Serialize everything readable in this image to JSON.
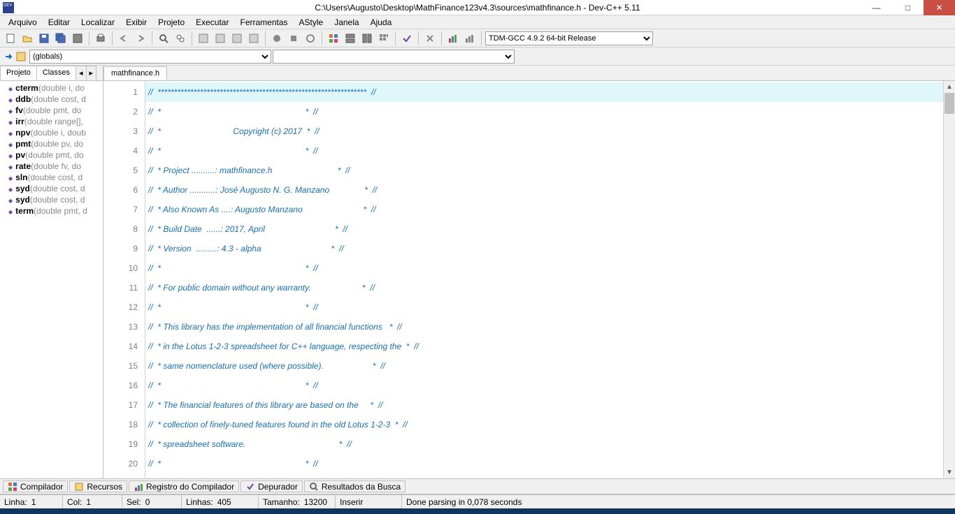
{
  "title": "C:\\Users\\Augusto\\Desktop\\MathFinance123v4.3\\sources\\mathfinance.h - Dev-C++ 5.11",
  "menu": [
    "Arquivo",
    "Editar",
    "Localizar",
    "Exibir",
    "Projeto",
    "Executar",
    "Ferramentas",
    "AStyle",
    "Janela",
    "Ajuda"
  ],
  "compiler_select": "TDM-GCC 4.9.2 64-bit Release",
  "scope_select": "(globals)",
  "side_tabs": {
    "projeto": "Projeto",
    "classes": "Classes"
  },
  "class_list": [
    {
      "name": "cterm",
      "sig": "(double i, do"
    },
    {
      "name": "ddb",
      "sig": "(double cost, d"
    },
    {
      "name": "fv",
      "sig": "(double pmt, do"
    },
    {
      "name": "irr",
      "sig": "(double range[],"
    },
    {
      "name": "npv",
      "sig": "(double i, doub"
    },
    {
      "name": "pmt",
      "sig": "(double pv, do"
    },
    {
      "name": "pv",
      "sig": "(double pmt, do"
    },
    {
      "name": "rate",
      "sig": "(double fv, do"
    },
    {
      "name": "sln",
      "sig": "(double cost, d"
    },
    {
      "name": "syd",
      "sig": "(double cost, d"
    },
    {
      "name": "syd",
      "sig": "(double cost, d"
    },
    {
      "name": "term",
      "sig": "(double pmt, d"
    }
  ],
  "editor_tab": "mathfinance.h",
  "code_lines": [
    "//  ****************************************************************  //",
    "//  *                                                              *  //",
    "//  *                               Copyright (c) 2017  *  //",
    "//  *                                                              *  //",
    "//  * Project ..........: mathfinance.h                            *  //",
    "//  * Author ...........: José Augusto N. G. Manzano               *  //",
    "//  * Also Known As ....: Augusto Manzano                          *  //",
    "//  * Build Date  ......: 2017, April                              *  //",
    "//  * Version  .........: 4.3 - alpha                              *  //",
    "//  *                                                              *  //",
    "//  * For public domain without any warranty.                      *  //",
    "//  *                                                              *  //",
    "//  * This library has the implementation of all financial functions   *  //",
    "//  * in the Lotus 1-2-3 spreadsheet for C++ language, respecting the  *  //",
    "//  * same nomenclature used (where possible).                     *  //",
    "//  *                                                              *  //",
    "//  * The financial features of this library are based on the     *  //",
    "//  * collection of finely-tuned features found in the old Lotus 1-2-3  *  //",
    "//  * spreadsheet software.                                        *  //",
    "//  *                                                              *  //"
  ],
  "line_numbers": [
    "1",
    "2",
    "3",
    "4",
    "5",
    "6",
    "7",
    "8",
    "9",
    "10",
    "11",
    "12",
    "13",
    "14",
    "15",
    "16",
    "17",
    "18",
    "19",
    "20"
  ],
  "bottom_tabs": [
    {
      "label": "Compilador"
    },
    {
      "label": "Recursos"
    },
    {
      "label": "Registro do Compilador"
    },
    {
      "label": "Depurador"
    },
    {
      "label": "Resultados da Busca"
    }
  ],
  "status": {
    "linha_label": "Linha:",
    "linha": "1",
    "col_label": "Col:",
    "col": "1",
    "sel_label": "Sel:",
    "sel": "0",
    "linhas_label": "Linhas:",
    "linhas": "405",
    "tamanho_label": "Tamanho:",
    "tamanho": "13200",
    "mode": "Inserir",
    "msg": "Done parsing in 0,078 seconds"
  }
}
